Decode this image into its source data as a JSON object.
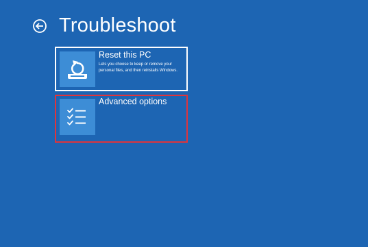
{
  "header": {
    "title": "Troubleshoot",
    "back_icon": "back-arrow-circle-icon"
  },
  "options": [
    {
      "title": "Reset this PC",
      "description": "Lets you choose to keep or remove your personal files, and then reinstalls Windows.",
      "icon": "reset-pc-icon",
      "highlighted": false
    },
    {
      "title": "Advanced options",
      "description": "",
      "icon": "checklist-icon",
      "highlighted": true
    }
  ],
  "colors": {
    "background": "#1d65b3",
    "tile_icon_bg": "#3d8dd6",
    "selected_border": "#ffffff",
    "highlight_border": "#e0343b",
    "text": "#ffffff"
  }
}
